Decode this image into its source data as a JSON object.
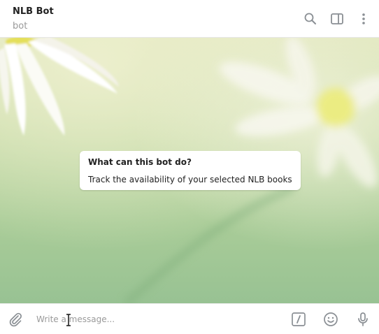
{
  "header": {
    "title": "NLB Bot",
    "subtitle": "bot",
    "icons": [
      "search-icon",
      "sidebar-toggle-icon",
      "more-vertical-icon"
    ]
  },
  "bot_info": {
    "title": "What can this bot do?",
    "description": "Track the availability of your selected NLB books"
  },
  "composer": {
    "placeholder": "Write a message...",
    "value": "",
    "icons": [
      "attach-icon",
      "commands-icon",
      "emoji-icon",
      "microphone-icon"
    ]
  },
  "colors": {
    "icon": "#8a8f94",
    "header_bg": "#ffffff",
    "card_bg": "#ffffff",
    "wallpaper_top": "#dfe6bb",
    "wallpaper_bottom": "#98c293"
  }
}
